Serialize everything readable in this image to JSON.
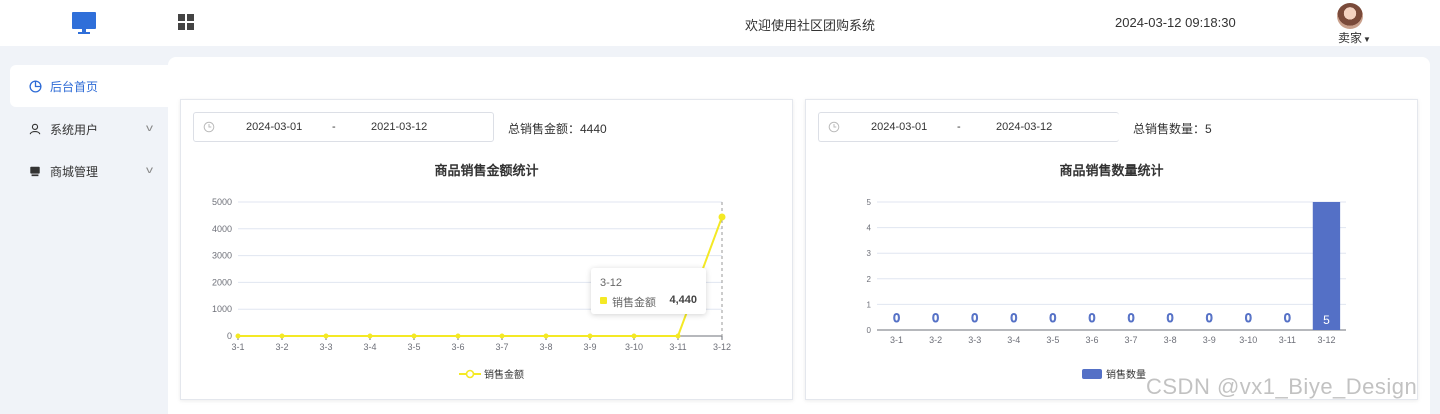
{
  "header": {
    "site_title": "欢迎使用社区团购系统",
    "datetime": "2024-03-12 09:18:30",
    "user_name": "卖家",
    "logo_icon": "monitor-icon",
    "menu_icon": "grid-icon"
  },
  "sidebar": {
    "items": [
      {
        "label": "后台首页",
        "icon": "pie-chart-icon",
        "active": true
      },
      {
        "label": "系统用户",
        "icon": "user-icon",
        "active": false
      },
      {
        "label": "商城管理",
        "icon": "shop-icon",
        "active": false
      }
    ]
  },
  "sales_amount_card": {
    "date_start": "2024-03-01",
    "date_sep": "-",
    "date_end": "2021-03-12",
    "total_label": "总销售金额：4440",
    "title": "商品销售金额统计",
    "tooltip": {
      "header": "3-12",
      "series": "销售金额",
      "value": "4,440"
    },
    "legend": "销售金额"
  },
  "sales_count_card": {
    "date_start": "2024-03-01",
    "date_sep": "-",
    "date_end": "2024-03-12",
    "total_label": "总销售数量：5",
    "title": "商品销售数量统计",
    "legend": "销售数量"
  },
  "chart_data": [
    {
      "type": "line",
      "title": "商品销售金额统计",
      "categories": [
        "3-1",
        "3-2",
        "3-3",
        "3-4",
        "3-5",
        "3-6",
        "3-7",
        "3-8",
        "3-9",
        "3-10",
        "3-11",
        "3-12"
      ],
      "series": [
        {
          "name": "销售金额",
          "values": [
            0,
            0,
            0,
            0,
            0,
            0,
            0,
            0,
            0,
            0,
            0,
            4440
          ]
        }
      ],
      "ylim": [
        0,
        5000
      ],
      "yticks": [
        0,
        1000,
        2000,
        3000,
        4000,
        5000
      ],
      "color": "#f4e925",
      "grid": true,
      "legend": "bottom-center"
    },
    {
      "type": "bar",
      "title": "商品销售数量统计",
      "categories": [
        "3-1",
        "3-2",
        "3-3",
        "3-4",
        "3-5",
        "3-6",
        "3-7",
        "3-8",
        "3-9",
        "3-10",
        "3-11",
        "3-12"
      ],
      "series": [
        {
          "name": "销售数量",
          "values": [
            0,
            0,
            0,
            0,
            0,
            0,
            0,
            0,
            0,
            0,
            0,
            5
          ]
        }
      ],
      "ylim": [
        0,
        5
      ],
      "yticks": [
        0,
        1,
        2,
        3,
        4,
        5
      ],
      "color": "#5470c6",
      "grid": true,
      "legend": "bottom-center"
    }
  ],
  "watermark": "CSDN @vx1_Biye_Design"
}
